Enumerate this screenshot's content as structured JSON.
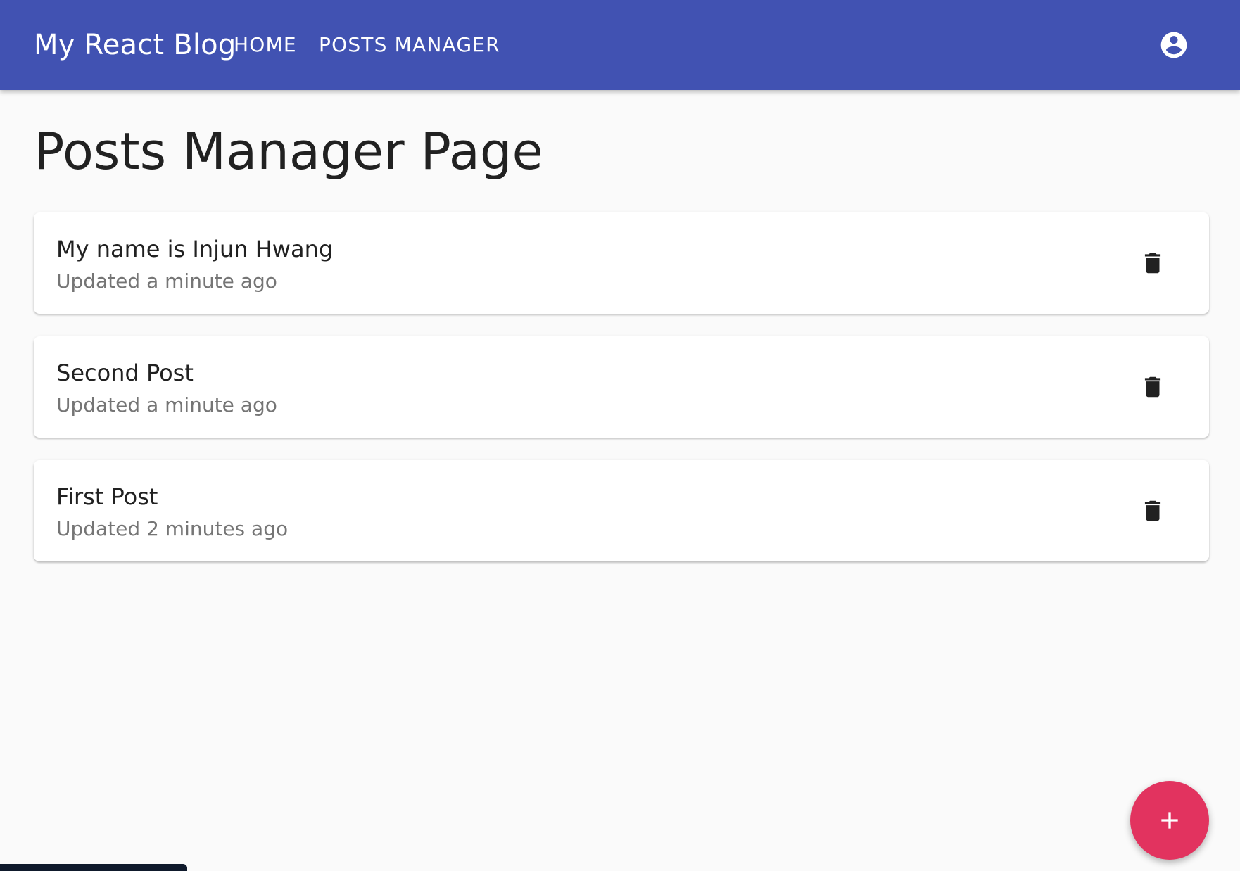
{
  "appbar": {
    "brand": "My React Blog",
    "nav": [
      {
        "label": "HOME"
      },
      {
        "label": "POSTS MANAGER"
      }
    ],
    "account_icon": "account-circle-icon",
    "color": "#4152b2"
  },
  "page": {
    "title": "Posts Manager Page"
  },
  "posts": [
    {
      "title": "My name is Injun Hwang",
      "updated": "Updated a minute ago",
      "action_icon": "delete-icon"
    },
    {
      "title": "Second Post",
      "updated": "Updated a minute ago",
      "action_icon": "delete-icon"
    },
    {
      "title": "First Post",
      "updated": "Updated 2 minutes ago",
      "action_icon": "delete-icon"
    }
  ],
  "fab": {
    "icon": "add-icon",
    "color": "#e2335f"
  }
}
